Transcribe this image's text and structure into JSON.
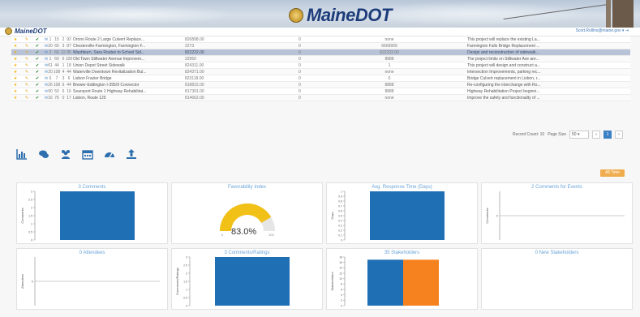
{
  "banner": {
    "title": "MaineDOT"
  },
  "header": {
    "logo_text": "MaineDOT",
    "user": "Scott.Rollins@maine.gov ▾",
    "user_extra": "⇥"
  },
  "table": {
    "rows": [
      {
        "n1": "1",
        "n2": "15",
        "n3": "2",
        "n4": "92",
        "name": "Orono Route 2 Large Culvert Replace...",
        "amount": "826898.00",
        "zero": "0",
        "pin": "none",
        "desc": "This project will replace the existing La..."
      },
      {
        "n1": "20",
        "n2": "60",
        "n3": "3",
        "n4": "87",
        "name": "Chesterville-Farmington, Farmington F...",
        "amount": "2273",
        "zero": "0",
        "pin": "6669999",
        "desc": "Farmington Falls Bridge Replacement ..."
      },
      {
        "n1": "2",
        "n2": "60",
        "n3": "22",
        "n4": "85",
        "name": "Washburn, Sara Routes to School Sid...",
        "amount": "822222.00",
        "zero": "0",
        "pin": "822222.00",
        "desc": "Design and reconstruction of sidewalk..."
      },
      {
        "n1": "1",
        "n2": "60",
        "n3": "6",
        "n4": "100",
        "name": "Old Town Stillwater Avenue Improvem...",
        "amount": "22950",
        "zero": "0",
        "pin": "8888",
        "desc": "The project limits on Stillwater Ave are..."
      },
      {
        "n1": "61",
        "n2": "44",
        "n3": "1",
        "n4": "18",
        "name": "Union Depot Street Sidewalk",
        "amount": "824311.00",
        "zero": "0",
        "pin": "1",
        "desc": "This project will design and construct a..."
      },
      {
        "n1": "20",
        "n2": "108",
        "n3": "4",
        "n4": "44",
        "name": "Waterville Downtown Revitalization Bul...",
        "amount": "824371.00",
        "zero": "0",
        "pin": "none",
        "desc": "Intersection Improvements, parking rec..."
      },
      {
        "n1": "6",
        "n2": "7",
        "n3": "3",
        "n4": "6",
        "name": "Lisbon Frazier Bridge",
        "amount": "823118.00",
        "zero": "0",
        "pin": "0",
        "desc": "Bridge Culvert replacement in Lisbon, r..."
      },
      {
        "n1": "26",
        "n2": "108",
        "n3": "6",
        "n4": "44",
        "name": "Brewer-Eddington I-395/9 Connector",
        "amount": "818815.00",
        "zero": "0",
        "pin": "8888",
        "desc": "Re-configuring the interchange with Ro..."
      },
      {
        "n1": "90",
        "n2": "50",
        "n3": "6",
        "n4": "16",
        "name": "Searsport Route 1 Highway Rehabilitat...",
        "amount": "817391.00",
        "zero": "0",
        "pin": "8888",
        "desc": "Highway Rehabilitation Project beginni..."
      },
      {
        "n1": "16",
        "n2": "76",
        "n3": "0",
        "n4": "17",
        "name": "Lisbon, Route 125",
        "amount": "814662.00",
        "zero": "0",
        "pin": "none",
        "desc": "Improve the safety and functionality of ..."
      }
    ]
  },
  "pager": {
    "record_count": "Record Count: 10",
    "page_size_label": "Page Size",
    "page_size": "50 ▾",
    "prev": "«",
    "page": "1",
    "next": "»"
  },
  "filter_button": "All Time",
  "panels": [
    {
      "title": "3 Comments",
      "ylabel": "Comments",
      "type": "bar"
    },
    {
      "title": "Favorability Index",
      "type": "gauge",
      "value": "83.0%",
      "min": "0",
      "max": "100"
    },
    {
      "title": "Avg. Response Time (Days)",
      "ylabel": "Days",
      "type": "bar"
    },
    {
      "title": "2 Comments for Events",
      "ylabel": "Comments",
      "type": "empty"
    },
    {
      "title": "0 Attendees",
      "ylabel": "Attendees",
      "type": "empty"
    },
    {
      "title": "3 Comments/Ratings",
      "ylabel": "Comments/Ratings",
      "type": "bar"
    },
    {
      "title": "35 Stakeholders",
      "ylabel": "Stakeholders",
      "type": "stack"
    },
    {
      "title": "0 New Stakeholders",
      "type": "blank"
    }
  ],
  "chart_data": [
    {
      "type": "bar",
      "title": "3 Comments",
      "ylabel": "Comments",
      "categories": [
        ""
      ],
      "values": [
        3
      ],
      "ylim": [
        0,
        3
      ],
      "yticks": [
        "0",
        "0.5",
        "1",
        "1.5",
        "2",
        "2.5",
        "3"
      ]
    },
    {
      "type": "gauge",
      "title": "Favorability Index",
      "value": 83.0,
      "min": 0,
      "max": 100
    },
    {
      "type": "bar",
      "title": "Avg. Response Time (Days)",
      "ylabel": "Days",
      "categories": [
        ""
      ],
      "values": [
        1
      ],
      "ylim": [
        0,
        1
      ],
      "yticks": [
        "0",
        "0.1",
        "0.2",
        "0.3",
        "0.4",
        "0.5",
        "0.6",
        "0.7",
        "0.8",
        "0.9",
        "1"
      ]
    },
    {
      "type": "bar",
      "title": "2 Comments for Events",
      "ylabel": "Comments",
      "categories": [],
      "values": [],
      "yticks": [
        "0"
      ]
    },
    {
      "type": "bar",
      "title": "0 Attendees",
      "ylabel": "Attendees",
      "categories": [],
      "values": [],
      "yticks": [
        "0"
      ]
    },
    {
      "type": "bar",
      "title": "3 Comments/Ratings",
      "ylabel": "Comments/Ratings",
      "categories": [
        ""
      ],
      "values": [
        3
      ],
      "ylim": [
        0,
        3
      ],
      "yticks": [
        "0",
        "0.5",
        "1",
        "1.5",
        "2",
        "2.5",
        "3"
      ]
    },
    {
      "type": "bar",
      "title": "35 Stakeholders",
      "ylabel": "Stakeholders",
      "categories": [
        "",
        ""
      ],
      "series": [
        {
          "values": [
            17,
            0
          ]
        },
        {
          "values": [
            0,
            17
          ]
        }
      ],
      "colors": [
        "#1f6fb5",
        "#f5821f"
      ],
      "ylim": [
        0,
        18
      ],
      "yticks": [
        "0",
        "2",
        "4",
        "6",
        "8",
        "10",
        "12",
        "14",
        "16",
        "18"
      ]
    },
    {
      "type": "bar",
      "title": "0 New Stakeholders",
      "categories": [],
      "values": []
    }
  ],
  "colors": {
    "bar": "#1f6fb5",
    "orange": "#f5821f",
    "gauge": "#f2c118",
    "gauge_bg": "#e6e6e6",
    "accent": "#3b7fc4"
  },
  "icons": [
    "stats-chart-icon",
    "comments-icon",
    "users-icon",
    "calendar-icon",
    "dashboard-icon",
    "upload-icon"
  ]
}
